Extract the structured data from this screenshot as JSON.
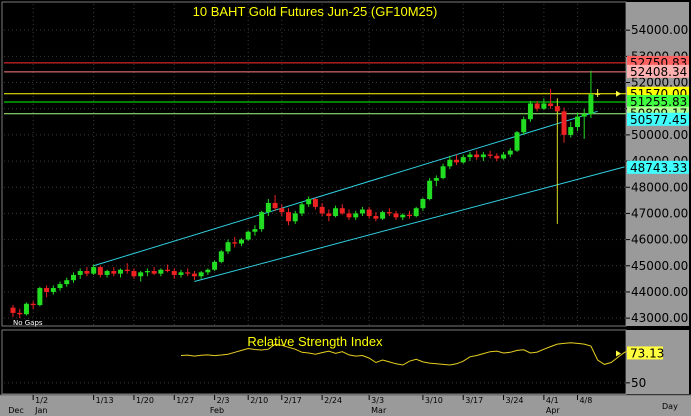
{
  "chart_data": [
    {
      "type": "candlestick",
      "title": "10 BAHT Gold Futures Jun-25 (GF10M25)",
      "ylim": [
        42700,
        55000
      ],
      "y_ticks": [
        43000,
        44000,
        45000,
        46000,
        47000,
        48000,
        49000,
        50000,
        51000,
        52000,
        53000,
        54000
      ],
      "y_tick_labels": [
        "43000.00",
        "44000.00",
        "45000.00",
        "46000.00",
        "47000.00",
        "48000.00",
        "49000.00",
        "50000.00",
        "51000.00",
        "52000.00",
        "53000.00",
        "54000.00"
      ],
      "horizontal_lines": [
        {
          "value": 52750.83,
          "label": "52750.83",
          "color": "#ff3030",
          "label_bg": "#ff6060"
        },
        {
          "value": 52408.34,
          "label": "52408.34",
          "color": "#ff8080",
          "label_bg": "#ffb0b0"
        },
        {
          "value": 51570.0,
          "label": "51570.00",
          "color": "#ffff00",
          "label_bg": "#ffff00"
        },
        {
          "value": 51255.83,
          "label": "51255.83",
          "color": "#00ff00",
          "label_bg": "#40ff40"
        },
        {
          "value": 50809.17,
          "label": "50809.17",
          "color": "#a0ff80",
          "label_bg": "#b0ff90"
        },
        {
          "value": 50577.45,
          "label": "50577.45",
          "color": "#00e0e0",
          "label_bg": "#40ffff"
        },
        {
          "value": 48743.33,
          "label": "48743.33",
          "color": "#00e0e0",
          "label_bg": "#40ffff"
        }
      ],
      "channel_upper": [
        {
          "i": 12,
          "y": 45000
        },
        {
          "i": 87,
          "y": 50900
        }
      ],
      "channel_lower": [
        {
          "i": 27,
          "y": 44400
        },
        {
          "i": 91,
          "y": 48780
        }
      ],
      "candles": [
        {
          "o": 43400,
          "h": 43500,
          "l": 43050,
          "c": 43200
        },
        {
          "o": 43200,
          "h": 43350,
          "l": 43000,
          "c": 43150
        },
        {
          "o": 43150,
          "h": 43600,
          "l": 43100,
          "c": 43550
        },
        {
          "o": 43550,
          "h": 43650,
          "l": 43350,
          "c": 43500
        },
        {
          "o": 43500,
          "h": 44200,
          "l": 43450,
          "c": 44150
        },
        {
          "o": 44150,
          "h": 44250,
          "l": 43800,
          "c": 44000
        },
        {
          "o": 44000,
          "h": 44250,
          "l": 43900,
          "c": 44150
        },
        {
          "o": 44150,
          "h": 44400,
          "l": 44050,
          "c": 44300
        },
        {
          "o": 44300,
          "h": 44550,
          "l": 44200,
          "c": 44450
        },
        {
          "o": 44450,
          "h": 44750,
          "l": 44350,
          "c": 44650
        },
        {
          "o": 44650,
          "h": 44900,
          "l": 44500,
          "c": 44800
        },
        {
          "o": 44800,
          "h": 44950,
          "l": 44600,
          "c": 44700
        },
        {
          "o": 44700,
          "h": 45050,
          "l": 44650,
          "c": 44950
        },
        {
          "o": 44950,
          "h": 45000,
          "l": 44550,
          "c": 44650
        },
        {
          "o": 44650,
          "h": 44850,
          "l": 44550,
          "c": 44800
        },
        {
          "o": 44800,
          "h": 44950,
          "l": 44600,
          "c": 44700
        },
        {
          "o": 44700,
          "h": 44900,
          "l": 44550,
          "c": 44850
        },
        {
          "o": 44850,
          "h": 45100,
          "l": 44700,
          "c": 44800
        },
        {
          "o": 44800,
          "h": 44900,
          "l": 44500,
          "c": 44600
        },
        {
          "o": 44600,
          "h": 44800,
          "l": 44400,
          "c": 44750
        },
        {
          "o": 44750,
          "h": 44900,
          "l": 44600,
          "c": 44800
        },
        {
          "o": 44800,
          "h": 44950,
          "l": 44650,
          "c": 44700
        },
        {
          "o": 44700,
          "h": 44900,
          "l": 44600,
          "c": 44850
        },
        {
          "o": 44850,
          "h": 45050,
          "l": 44750,
          "c": 44800
        },
        {
          "o": 44800,
          "h": 44900,
          "l": 44500,
          "c": 44650
        },
        {
          "o": 44650,
          "h": 44850,
          "l": 44550,
          "c": 44750
        },
        {
          "o": 44750,
          "h": 44900,
          "l": 44600,
          "c": 44700
        },
        {
          "o": 44700,
          "h": 44800,
          "l": 44450,
          "c": 44600
        },
        {
          "o": 44600,
          "h": 44800,
          "l": 44500,
          "c": 44750
        },
        {
          "o": 44750,
          "h": 44900,
          "l": 44650,
          "c": 44850
        },
        {
          "o": 44850,
          "h": 45200,
          "l": 44800,
          "c": 45150
        },
        {
          "o": 45150,
          "h": 45600,
          "l": 45100,
          "c": 45550
        },
        {
          "o": 45550,
          "h": 46000,
          "l": 45450,
          "c": 45900
        },
        {
          "o": 45900,
          "h": 46100,
          "l": 45700,
          "c": 45850
        },
        {
          "o": 45850,
          "h": 46050,
          "l": 45750,
          "c": 46000
        },
        {
          "o": 46000,
          "h": 46350,
          "l": 45950,
          "c": 46300
        },
        {
          "o": 46300,
          "h": 46550,
          "l": 46150,
          "c": 46400
        },
        {
          "o": 46400,
          "h": 47100,
          "l": 46300,
          "c": 47050
        },
        {
          "o": 47050,
          "h": 47550,
          "l": 46900,
          "c": 47400
        },
        {
          "o": 47400,
          "h": 47700,
          "l": 47100,
          "c": 47200
        },
        {
          "o": 47200,
          "h": 47350,
          "l": 46900,
          "c": 47050
        },
        {
          "o": 47050,
          "h": 47200,
          "l": 46550,
          "c": 46700
        },
        {
          "o": 46700,
          "h": 47100,
          "l": 46600,
          "c": 47000
        },
        {
          "o": 47000,
          "h": 47450,
          "l": 46900,
          "c": 47350
        },
        {
          "o": 47350,
          "h": 47650,
          "l": 47250,
          "c": 47550
        },
        {
          "o": 47550,
          "h": 47600,
          "l": 47150,
          "c": 47250
        },
        {
          "o": 47250,
          "h": 47400,
          "l": 46900,
          "c": 47000
        },
        {
          "o": 47000,
          "h": 47150,
          "l": 46700,
          "c": 46900
        },
        {
          "o": 46900,
          "h": 47300,
          "l": 46850,
          "c": 47200
        },
        {
          "o": 47200,
          "h": 47350,
          "l": 46950,
          "c": 47000
        },
        {
          "o": 47000,
          "h": 47150,
          "l": 46750,
          "c": 46850
        },
        {
          "o": 46850,
          "h": 47100,
          "l": 46750,
          "c": 47000
        },
        {
          "o": 47000,
          "h": 47250,
          "l": 46900,
          "c": 47150
        },
        {
          "o": 47150,
          "h": 47250,
          "l": 46800,
          "c": 46900
        },
        {
          "o": 46900,
          "h": 47050,
          "l": 46700,
          "c": 46800
        },
        {
          "o": 46800,
          "h": 47100,
          "l": 46750,
          "c": 47050
        },
        {
          "o": 47050,
          "h": 47200,
          "l": 46900,
          "c": 47000
        },
        {
          "o": 47000,
          "h": 47100,
          "l": 46750,
          "c": 46850
        },
        {
          "o": 46850,
          "h": 47000,
          "l": 46750,
          "c": 46950
        },
        {
          "o": 46950,
          "h": 47100,
          "l": 46800,
          "c": 46900
        },
        {
          "o": 46900,
          "h": 47250,
          "l": 46850,
          "c": 47200
        },
        {
          "o": 47200,
          "h": 47600,
          "l": 47100,
          "c": 47550
        },
        {
          "o": 47550,
          "h": 48350,
          "l": 47500,
          "c": 48250
        },
        {
          "o": 48250,
          "h": 48450,
          "l": 48050,
          "c": 48350
        },
        {
          "o": 48350,
          "h": 48900,
          "l": 48300,
          "c": 48800
        },
        {
          "o": 48800,
          "h": 49200,
          "l": 48700,
          "c": 49050
        },
        {
          "o": 49050,
          "h": 49250,
          "l": 48850,
          "c": 48950
        },
        {
          "o": 48950,
          "h": 49250,
          "l": 48900,
          "c": 49150
        },
        {
          "o": 49150,
          "h": 49350,
          "l": 49000,
          "c": 49250
        },
        {
          "o": 49250,
          "h": 49400,
          "l": 49050,
          "c": 49150
        },
        {
          "o": 49150,
          "h": 49350,
          "l": 49000,
          "c": 49250
        },
        {
          "o": 49250,
          "h": 49400,
          "l": 49100,
          "c": 49200
        },
        {
          "o": 49200,
          "h": 49300,
          "l": 49000,
          "c": 49100
        },
        {
          "o": 49100,
          "h": 49350,
          "l": 49050,
          "c": 49250
        },
        {
          "o": 49250,
          "h": 49500,
          "l": 49150,
          "c": 49400
        },
        {
          "o": 49400,
          "h": 50150,
          "l": 49350,
          "c": 50100
        },
        {
          "o": 50100,
          "h": 50700,
          "l": 50000,
          "c": 50600
        },
        {
          "o": 50600,
          "h": 51300,
          "l": 50500,
          "c": 51200
        },
        {
          "o": 51200,
          "h": 51300,
          "l": 50900,
          "c": 51000
        },
        {
          "o": 51000,
          "h": 51400,
          "l": 50950,
          "c": 51200
        },
        {
          "o": 51200,
          "h": 51750,
          "l": 51000,
          "c": 51100
        },
        {
          "o": 51100,
          "h": 51400,
          "l": 46600,
          "c": 50900
        },
        {
          "o": 50900,
          "h": 51050,
          "l": 49700,
          "c": 50000
        },
        {
          "o": 50000,
          "h": 50500,
          "l": 49900,
          "c": 50300
        },
        {
          "o": 50300,
          "h": 50850,
          "l": 50150,
          "c": 50700
        },
        {
          "o": 50700,
          "h": 51000,
          "l": 49850,
          "c": 50800
        },
        {
          "o": 50800,
          "h": 52450,
          "l": 50650,
          "c": 51550
        },
        {
          "o": 51550,
          "h": 51750,
          "l": 51450,
          "c": 51570
        }
      ],
      "x_labels": [
        "1/2",
        "1/13",
        "1/20",
        "1/27",
        "2/3",
        "2/10",
        "2/17",
        "2/24",
        "3/3",
        "3/10",
        "3/17",
        "3/24",
        "4/1",
        "4/8"
      ],
      "month_labels": [
        "Dec",
        "Jan",
        "Feb",
        "Mar",
        "Apr"
      ],
      "x_axis_unit": "Day",
      "note": "No Gaps"
    },
    {
      "type": "line",
      "title": "Relative Strength Index",
      "ylim": [
        42,
        90
      ],
      "y_ticks": [
        50
      ],
      "y_tick_labels": [
        "50"
      ],
      "last_value": 73.13,
      "last_label": "73.13",
      "start_index": 25,
      "values": [
        71.5,
        71.8,
        71.0,
        71.7,
        72.0,
        71.4,
        71.9,
        72.5,
        74.0,
        75.5,
        77.0,
        76.2,
        75.8,
        76.5,
        80.5,
        79.5,
        78.0,
        76.5,
        74.0,
        73.5,
        72.5,
        73.8,
        75.0,
        73.2,
        74.5,
        72.0,
        71.0,
        71.5,
        69.5,
        66.0,
        68.0,
        66.5,
        65.0,
        64.0,
        67.0,
        68.5,
        66.5,
        65.5,
        65.0,
        64.5,
        64.0,
        65.0,
        67.0,
        70.5,
        71.5,
        73.0,
        74.5,
        75.0,
        73.5,
        74.0,
        75.5,
        76.0,
        73.5,
        74.2,
        76.5,
        78.5,
        80.5,
        81.0,
        81.5,
        81.0,
        80.5,
        79.0,
        68.0,
        64.5,
        66.0,
        70.0,
        74.0,
        75.5,
        73.13
      ]
    }
  ]
}
